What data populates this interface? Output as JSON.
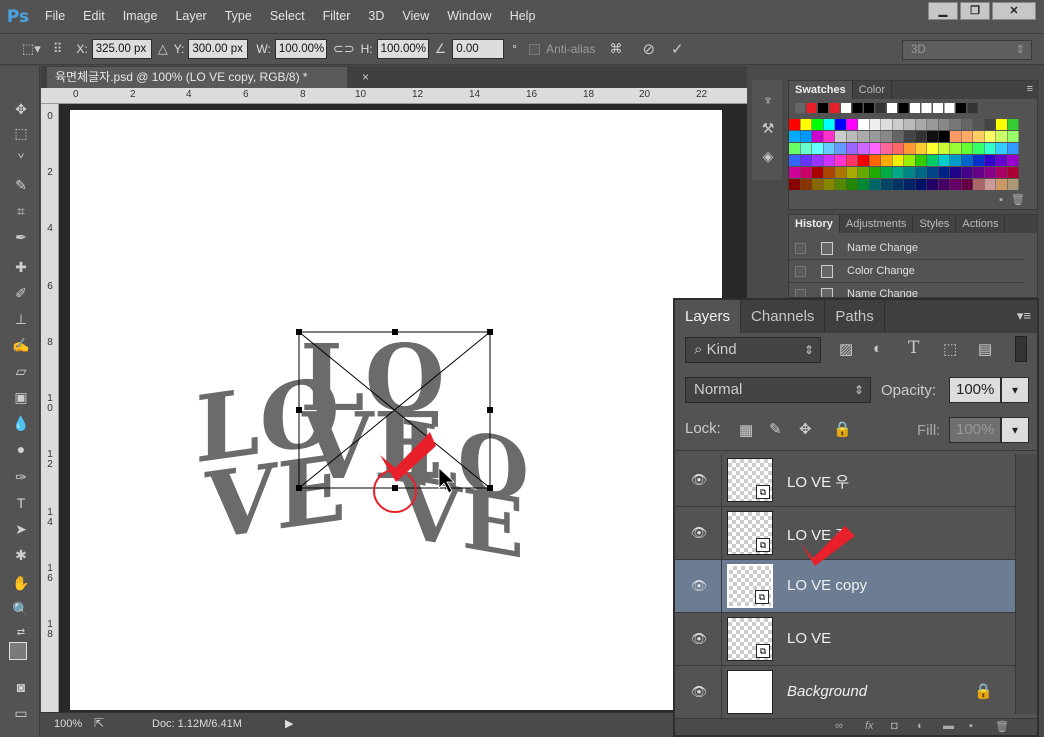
{
  "app": {
    "logo": "Ps"
  },
  "menu": [
    "File",
    "Edit",
    "Image",
    "Layer",
    "Type",
    "Select",
    "Filter",
    "3D",
    "View",
    "Window",
    "Help"
  ],
  "window_controls": {
    "minimize": "▁",
    "restore": "❐",
    "close": "✕"
  },
  "options": {
    "x_label": "X:",
    "x_value": "325.00 px",
    "y_label": "Y:",
    "y_value": "300.00 px",
    "w_label": "W:",
    "w_value": "100.00%",
    "h_label": "H:",
    "h_value": "100.00%",
    "angle_value": "0.00",
    "angle_unit": "°",
    "antialias": "Anti-alias",
    "workspace": "3D"
  },
  "document": {
    "tab_title": "육면체글자.psd @ 100% (LO VE copy, RGB/8) *",
    "close": "×",
    "ruler_top": [
      "0",
      "2",
      "4",
      "6",
      "8",
      "10",
      "12",
      "14",
      "16",
      "18",
      "20",
      "22"
    ],
    "ruler_left": [
      "0",
      "2",
      "4",
      "6",
      "8",
      "10",
      "12",
      "14",
      "16",
      "18"
    ]
  },
  "status": {
    "zoom": "100%",
    "doc": "Doc: 1.12M/6.41M"
  },
  "swatches_panel": {
    "tabs": [
      "Swatches",
      "Color"
    ]
  },
  "history_panel": {
    "tabs": [
      "History",
      "Adjustments",
      "Styles",
      "Actions"
    ],
    "items": [
      "Name Change",
      "Color Change",
      "Name Change"
    ]
  },
  "layers_panel": {
    "tabs": [
      "Layers",
      "Channels",
      "Paths"
    ],
    "filter_label": "Kind",
    "blend_mode": "Normal",
    "opacity_label": "Opacity:",
    "opacity_value": "100%",
    "lock_label": "Lock:",
    "fill_label": "Fill:",
    "fill_value": "100%",
    "layers": [
      {
        "name": "LO VE 우",
        "selected": false
      },
      {
        "name": "LO VE 좌",
        "selected": false
      },
      {
        "name": "LO VE copy",
        "selected": true
      },
      {
        "name": "LO VE",
        "selected": false
      },
      {
        "name": "Background",
        "selected": false
      }
    ]
  },
  "canvas_text": {
    "lo": "LO",
    "ve": "VE"
  },
  "colors": {
    "accent_red": "#e8202a",
    "text_gray": "#6b6b6b",
    "selection": "#6b7c93"
  }
}
